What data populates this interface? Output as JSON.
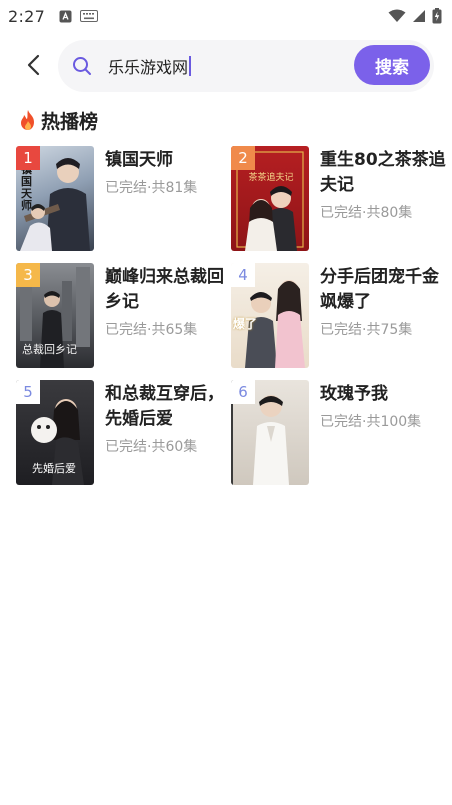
{
  "status_bar": {
    "time": "2:27"
  },
  "search": {
    "value": "乐乐游戏网",
    "button_label": "搜索"
  },
  "section": {
    "title": "热播榜"
  },
  "dramas": [
    {
      "rank": "1",
      "title": "镇国天师",
      "status": "已完结·共81集",
      "cover_caption": "镇国天师"
    },
    {
      "rank": "2",
      "title": "重生80之茶茶追夫记",
      "status": "已完结·共80集",
      "cover_caption": "茶茶追夫记"
    },
    {
      "rank": "3",
      "title": "巅峰归来总裁回乡记",
      "status": "已完结·共65集",
      "cover_caption": "总裁回乡记"
    },
    {
      "rank": "4",
      "title": "分手后团宠千金飒爆了",
      "status": "已完结·共75集",
      "cover_caption": "爆了"
    },
    {
      "rank": "5",
      "title": "和总裁互穿后，先婚后爱",
      "status": "已完结·共60集",
      "cover_caption": "先婚后爱"
    },
    {
      "rank": "6",
      "title": "玫瑰予我",
      "status": "已完结·共100集",
      "cover_caption": ""
    }
  ],
  "colors": {
    "accent": "#7b61ea",
    "rank_1": "#e8483f",
    "rank_2": "#f08a4b",
    "rank_3": "#f5b84a",
    "rank_other": "#ffffff",
    "rank_other_text": "#7b8ae0"
  }
}
